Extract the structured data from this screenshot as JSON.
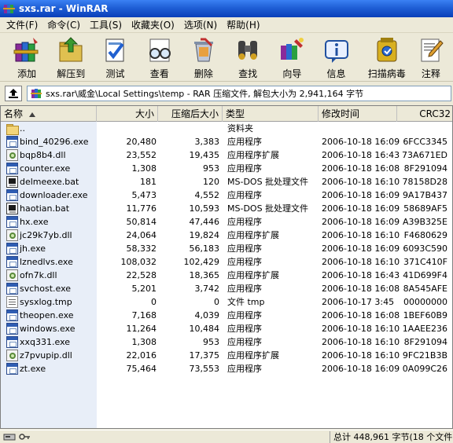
{
  "window": {
    "title": "sxs.rar - WinRAR"
  },
  "menu": [
    "文件(F)",
    "命令(C)",
    "工具(S)",
    "收藏夹(O)",
    "选项(N)",
    "帮助(H)"
  ],
  "toolbar": [
    {
      "label": "添加",
      "icon": "books-add-icon"
    },
    {
      "label": "解压到",
      "icon": "extract-folder-icon"
    },
    {
      "label": "测试",
      "icon": "test-check-icon"
    },
    {
      "label": "查看",
      "icon": "glasses-view-icon"
    },
    {
      "label": "删除",
      "icon": "recycle-bin-icon"
    },
    {
      "label": "查找",
      "icon": "binoculars-find-icon"
    },
    {
      "label": "向导",
      "icon": "wizard-icon"
    },
    {
      "label": "信息",
      "icon": "info-icon"
    },
    {
      "label": "扫描病毒",
      "icon": "virus-scan-icon"
    },
    {
      "label": "注释",
      "icon": "comment-pen-icon"
    }
  ],
  "address": {
    "path": "sxs.rar\\威金\\Local Settings\\temp - RAR 压缩文件, 解包大小为 2,941,164 字节"
  },
  "columns": {
    "name": "名称",
    "size": "大小",
    "packed": "压缩后大小",
    "type": "类型",
    "modified": "修改时间",
    "crc": "CRC32"
  },
  "files": [
    {
      "name": "..",
      "size": "",
      "packed": "",
      "type": "资料夹",
      "modified": "",
      "crc": "",
      "icon": "folder"
    },
    {
      "name": "bind_40296.exe",
      "size": "20,480",
      "packed": "3,383",
      "type": "应用程序",
      "modified": "2006-10-18 16:09",
      "crc": "6FCC3345",
      "icon": "exe"
    },
    {
      "name": "bqp8b4.dll",
      "size": "23,552",
      "packed": "19,435",
      "type": "应用程序扩展",
      "modified": "2006-10-18 16:43",
      "crc": "73A671ED",
      "icon": "dll"
    },
    {
      "name": "counter.exe",
      "size": "1,308",
      "packed": "953",
      "type": "应用程序",
      "modified": "2006-10-18 16:08",
      "crc": "8F291094",
      "icon": "exe"
    },
    {
      "name": "delmeexe.bat",
      "size": "181",
      "packed": "120",
      "type": "MS-DOS 批处理文件",
      "modified": "2006-10-18 16:10",
      "crc": "78158D28",
      "icon": "bat"
    },
    {
      "name": "downloader.exe",
      "size": "5,473",
      "packed": "4,552",
      "type": "应用程序",
      "modified": "2006-10-18 16:09",
      "crc": "9A17B437",
      "icon": "exe"
    },
    {
      "name": "haotian.bat",
      "size": "11,776",
      "packed": "10,593",
      "type": "MS-DOS 批处理文件",
      "modified": "2006-10-18 16:09",
      "crc": "58689AF5",
      "icon": "bat"
    },
    {
      "name": "hx.exe",
      "size": "50,814",
      "packed": "47,446",
      "type": "应用程序",
      "modified": "2006-10-18 16:09",
      "crc": "A39B325E",
      "icon": "exe"
    },
    {
      "name": "jc29k7yb.dll",
      "size": "24,064",
      "packed": "19,824",
      "type": "应用程序扩展",
      "modified": "2006-10-18 16:10",
      "crc": "F4680629",
      "icon": "dll"
    },
    {
      "name": "jh.exe",
      "size": "58,332",
      "packed": "56,183",
      "type": "应用程序",
      "modified": "2006-10-18 16:09",
      "crc": "6093C590",
      "icon": "exe"
    },
    {
      "name": "lznedlvs.exe",
      "size": "108,032",
      "packed": "102,429",
      "type": "应用程序",
      "modified": "2006-10-18 16:10",
      "crc": "371C410F",
      "icon": "exe"
    },
    {
      "name": "ofn7k.dll",
      "size": "22,528",
      "packed": "18,365",
      "type": "应用程序扩展",
      "modified": "2006-10-18 16:43",
      "crc": "41D699F4",
      "icon": "dll"
    },
    {
      "name": "svchost.exe",
      "size": "5,201",
      "packed": "3,742",
      "type": "应用程序",
      "modified": "2006-10-18 16:08",
      "crc": "8A545AFE",
      "icon": "exe"
    },
    {
      "name": "sysxlog.tmp",
      "size": "0",
      "packed": "0",
      "type": "文件 tmp",
      "modified": "2006-10-17 3:45",
      "crc": "00000000",
      "icon": "tmp"
    },
    {
      "name": "theopen.exe",
      "size": "7,168",
      "packed": "4,039",
      "type": "应用程序",
      "modified": "2006-10-18 16:08",
      "crc": "1BEF60B9",
      "icon": "exe"
    },
    {
      "name": "windows.exe",
      "size": "11,264",
      "packed": "10,484",
      "type": "应用程序",
      "modified": "2006-10-18 16:10",
      "crc": "1AAEE236",
      "icon": "exe"
    },
    {
      "name": "xxq331.exe",
      "size": "1,308",
      "packed": "953",
      "type": "应用程序",
      "modified": "2006-10-18 16:10",
      "crc": "8F291094",
      "icon": "exe"
    },
    {
      "name": "z7pvupip.dll",
      "size": "22,016",
      "packed": "17,375",
      "type": "应用程序扩展",
      "modified": "2006-10-18 16:10",
      "crc": "9FC21B3B",
      "icon": "dll"
    },
    {
      "name": "zt.exe",
      "size": "75,464",
      "packed": "73,553",
      "type": "应用程序",
      "modified": "2006-10-18 16:09",
      "crc": "0A099C26",
      "icon": "exe"
    }
  ],
  "status": {
    "summary": "总计 448,961 字节(18 个文件)"
  },
  "colors": {
    "title_bar": "#0a3fb8",
    "selected_column": "#e8eef8",
    "chrome": "#ece9d8"
  }
}
